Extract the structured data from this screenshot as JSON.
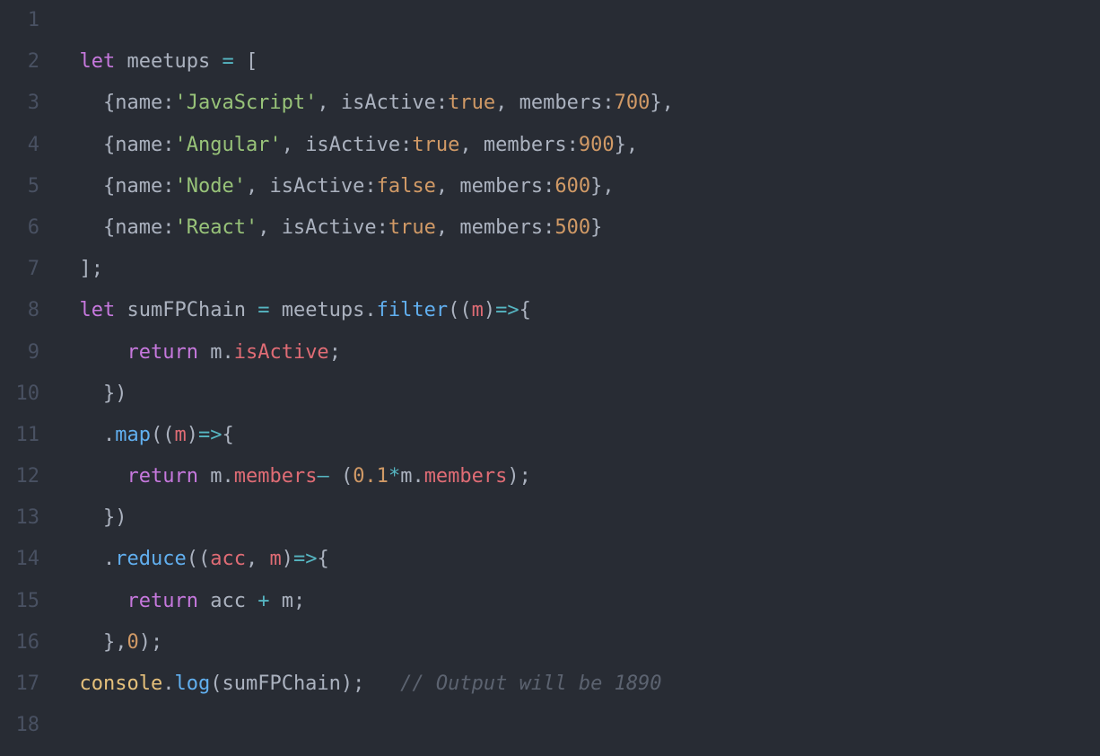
{
  "theme": {
    "background": "#282c34",
    "gutter": "#495162",
    "default": "#abb2bf",
    "keyword": "#c678dd",
    "variable": "#e06c75",
    "function": "#61afef",
    "string": "#98c379",
    "number": "#d19a66",
    "boolean": "#d19a66",
    "constant": "#e5c07b",
    "operator": "#56b6c2",
    "comment": "#5c6370"
  },
  "line_numbers": [
    "1",
    "2",
    "3",
    "4",
    "5",
    "6",
    "7",
    "8",
    "9",
    "10",
    "11",
    "12",
    "13",
    "14",
    "15",
    "16",
    "17",
    "18"
  ],
  "code_lines": [
    {
      "indent": "",
      "tokens": []
    },
    {
      "indent": "  ",
      "tokens": [
        {
          "t": "keyword",
          "v": "let"
        },
        {
          "t": "plain",
          "v": " "
        },
        {
          "t": "plain",
          "v": "meetups "
        },
        {
          "t": "op",
          "v": "="
        },
        {
          "t": "plain",
          "v": " "
        },
        {
          "t": "punct",
          "v": "["
        }
      ]
    },
    {
      "indent": "    ",
      "tokens": [
        {
          "t": "punct",
          "v": "{"
        },
        {
          "t": "plain",
          "v": "name"
        },
        {
          "t": "punct",
          "v": ":"
        },
        {
          "t": "string",
          "v": "'JavaScript'"
        },
        {
          "t": "punct",
          "v": ", "
        },
        {
          "t": "plain",
          "v": "isActive"
        },
        {
          "t": "punct",
          "v": ":"
        },
        {
          "t": "bool",
          "v": "true"
        },
        {
          "t": "punct",
          "v": ", "
        },
        {
          "t": "plain",
          "v": "members"
        },
        {
          "t": "punct",
          "v": ":"
        },
        {
          "t": "num",
          "v": "700"
        },
        {
          "t": "punct",
          "v": "},"
        }
      ]
    },
    {
      "indent": "    ",
      "tokens": [
        {
          "t": "punct",
          "v": "{"
        },
        {
          "t": "plain",
          "v": "name"
        },
        {
          "t": "punct",
          "v": ":"
        },
        {
          "t": "string",
          "v": "'Angular'"
        },
        {
          "t": "punct",
          "v": ", "
        },
        {
          "t": "plain",
          "v": "isActive"
        },
        {
          "t": "punct",
          "v": ":"
        },
        {
          "t": "bool",
          "v": "true"
        },
        {
          "t": "punct",
          "v": ", "
        },
        {
          "t": "plain",
          "v": "members"
        },
        {
          "t": "punct",
          "v": ":"
        },
        {
          "t": "num",
          "v": "900"
        },
        {
          "t": "punct",
          "v": "},"
        }
      ]
    },
    {
      "indent": "    ",
      "tokens": [
        {
          "t": "punct",
          "v": "{"
        },
        {
          "t": "plain",
          "v": "name"
        },
        {
          "t": "punct",
          "v": ":"
        },
        {
          "t": "string",
          "v": "'Node'"
        },
        {
          "t": "punct",
          "v": ", "
        },
        {
          "t": "plain",
          "v": "isActive"
        },
        {
          "t": "punct",
          "v": ":"
        },
        {
          "t": "bool",
          "v": "false"
        },
        {
          "t": "punct",
          "v": ", "
        },
        {
          "t": "plain",
          "v": "members"
        },
        {
          "t": "punct",
          "v": ":"
        },
        {
          "t": "num",
          "v": "600"
        },
        {
          "t": "punct",
          "v": "},"
        }
      ]
    },
    {
      "indent": "    ",
      "tokens": [
        {
          "t": "punct",
          "v": "{"
        },
        {
          "t": "plain",
          "v": "name"
        },
        {
          "t": "punct",
          "v": ":"
        },
        {
          "t": "string",
          "v": "'React'"
        },
        {
          "t": "punct",
          "v": ", "
        },
        {
          "t": "plain",
          "v": "isActive"
        },
        {
          "t": "punct",
          "v": ":"
        },
        {
          "t": "bool",
          "v": "true"
        },
        {
          "t": "punct",
          "v": ", "
        },
        {
          "t": "plain",
          "v": "members"
        },
        {
          "t": "punct",
          "v": ":"
        },
        {
          "t": "num",
          "v": "500"
        },
        {
          "t": "punct",
          "v": "}"
        }
      ]
    },
    {
      "indent": "  ",
      "tokens": [
        {
          "t": "punct",
          "v": "];"
        }
      ]
    },
    {
      "indent": "  ",
      "tokens": [
        {
          "t": "keyword",
          "v": "let"
        },
        {
          "t": "plain",
          "v": " "
        },
        {
          "t": "plain",
          "v": "sumFPChain "
        },
        {
          "t": "op",
          "v": "="
        },
        {
          "t": "plain",
          "v": " meetups"
        },
        {
          "t": "punct",
          "v": "."
        },
        {
          "t": "func",
          "v": "filter"
        },
        {
          "t": "punct",
          "v": "(("
        },
        {
          "t": "var",
          "v": "m"
        },
        {
          "t": "punct",
          "v": ")"
        },
        {
          "t": "op",
          "v": "=>"
        },
        {
          "t": "punct",
          "v": "{"
        }
      ]
    },
    {
      "indent": "      ",
      "tokens": [
        {
          "t": "keyword",
          "v": "return"
        },
        {
          "t": "plain",
          "v": " m"
        },
        {
          "t": "punct",
          "v": "."
        },
        {
          "t": "var",
          "v": "isActive"
        },
        {
          "t": "punct",
          "v": ";"
        }
      ]
    },
    {
      "indent": "    ",
      "tokens": [
        {
          "t": "punct",
          "v": "})"
        }
      ]
    },
    {
      "indent": "    ",
      "tokens": [
        {
          "t": "punct",
          "v": "."
        },
        {
          "t": "func",
          "v": "map"
        },
        {
          "t": "punct",
          "v": "(("
        },
        {
          "t": "var",
          "v": "m"
        },
        {
          "t": "punct",
          "v": ")"
        },
        {
          "t": "op",
          "v": "=>"
        },
        {
          "t": "punct",
          "v": "{"
        }
      ]
    },
    {
      "indent": "      ",
      "tokens": [
        {
          "t": "keyword",
          "v": "return"
        },
        {
          "t": "plain",
          "v": " m"
        },
        {
          "t": "punct",
          "v": "."
        },
        {
          "t": "var",
          "v": "members"
        },
        {
          "t": "op",
          "v": "–"
        },
        {
          "t": "plain",
          "v": " "
        },
        {
          "t": "punct",
          "v": "("
        },
        {
          "t": "num",
          "v": "0.1"
        },
        {
          "t": "op",
          "v": "*"
        },
        {
          "t": "plain",
          "v": "m"
        },
        {
          "t": "punct",
          "v": "."
        },
        {
          "t": "var",
          "v": "members"
        },
        {
          "t": "punct",
          "v": ");"
        }
      ]
    },
    {
      "indent": "    ",
      "tokens": [
        {
          "t": "punct",
          "v": "})"
        }
      ]
    },
    {
      "indent": "    ",
      "tokens": [
        {
          "t": "punct",
          "v": "."
        },
        {
          "t": "func",
          "v": "reduce"
        },
        {
          "t": "punct",
          "v": "(("
        },
        {
          "t": "var",
          "v": "acc"
        },
        {
          "t": "punct",
          "v": ", "
        },
        {
          "t": "var",
          "v": "m"
        },
        {
          "t": "punct",
          "v": ")"
        },
        {
          "t": "op",
          "v": "=>"
        },
        {
          "t": "punct",
          "v": "{"
        }
      ]
    },
    {
      "indent": "      ",
      "tokens": [
        {
          "t": "keyword",
          "v": "return"
        },
        {
          "t": "plain",
          "v": " acc "
        },
        {
          "t": "op",
          "v": "+"
        },
        {
          "t": "plain",
          "v": " m"
        },
        {
          "t": "punct",
          "v": ";"
        }
      ]
    },
    {
      "indent": "    ",
      "tokens": [
        {
          "t": "punct",
          "v": "},"
        },
        {
          "t": "num",
          "v": "0"
        },
        {
          "t": "punct",
          "v": ");"
        }
      ]
    },
    {
      "indent": "  ",
      "tokens": [
        {
          "t": "const",
          "v": "console"
        },
        {
          "t": "punct",
          "v": "."
        },
        {
          "t": "func",
          "v": "log"
        },
        {
          "t": "punct",
          "v": "("
        },
        {
          "t": "plain",
          "v": "sumFPChain"
        },
        {
          "t": "punct",
          "v": ");   "
        },
        {
          "t": "comment",
          "v": "// Output will be 1890"
        }
      ]
    },
    {
      "indent": "",
      "tokens": []
    }
  ]
}
